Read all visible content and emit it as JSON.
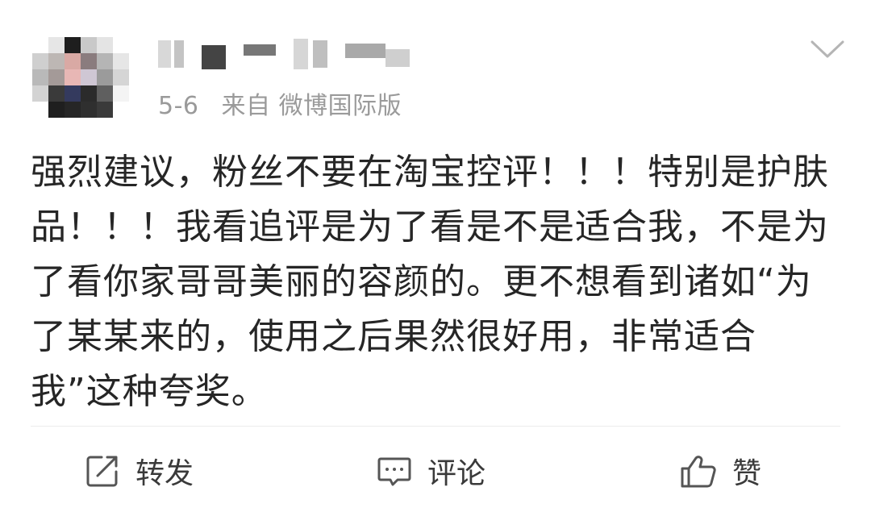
{
  "post": {
    "meta": {
      "date": "5-6",
      "source": "来自 微博国际版"
    },
    "content": "强烈建议，粉丝不要在淘宝控评！！！特别是护肤品！！！我看追评是为了看是不是适合我，不是为了看你家哥哥美丽的容颜的。更不想看到诸如“为了某某来的，使用之后果然很好用，非常适合我”这种夸奖。",
    "actions": {
      "repost_label": "转发",
      "comment_label": "评论",
      "like_label": "赞"
    }
  },
  "colors": {
    "text": "#262626",
    "meta": "#9a9a9a",
    "icon": "#555555",
    "divider": "#ececec"
  },
  "icons": [
    "chevron-down-icon",
    "repost-icon",
    "comment-icon",
    "like-icon"
  ]
}
